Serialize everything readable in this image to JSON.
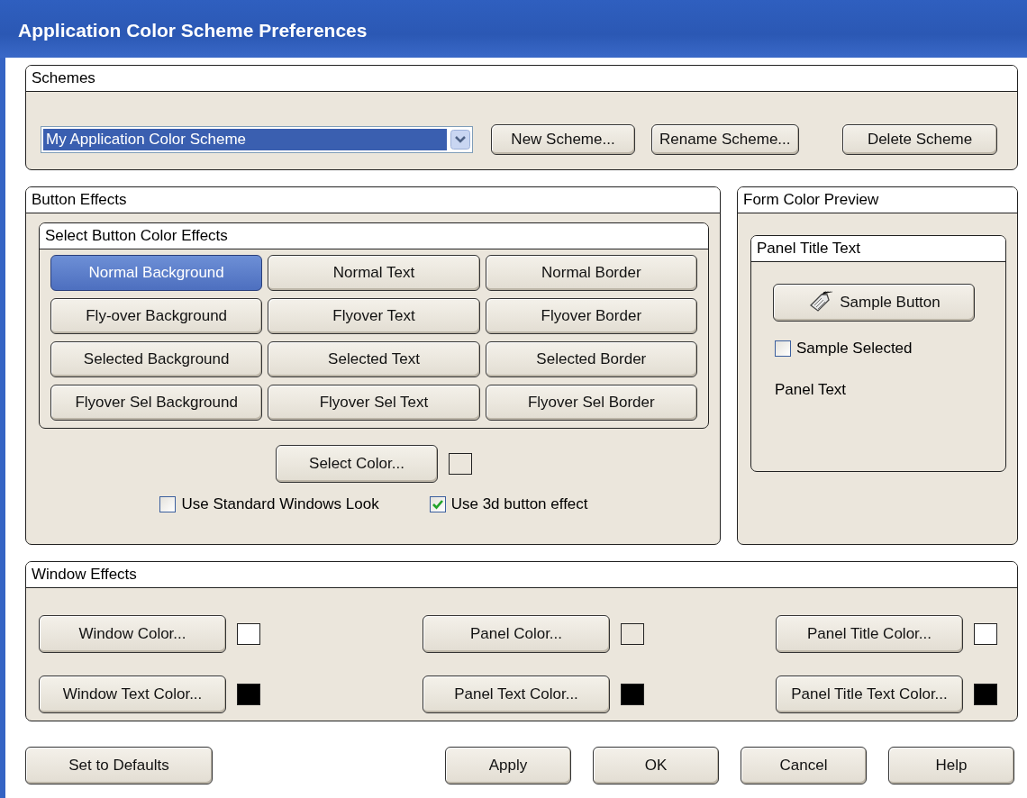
{
  "window": {
    "title": "Application Color Scheme Preferences"
  },
  "schemes": {
    "title": "Schemes",
    "dropdown": {
      "value": "My Application Color Scheme"
    },
    "buttons": [
      "New Scheme...",
      "Rename Scheme...",
      "Delete Scheme"
    ]
  },
  "button_effects": {
    "title": "Button Effects",
    "group_title": "Select Button Color Effects",
    "effects": [
      {
        "label": "Normal Background",
        "selected": true
      },
      {
        "label": "Normal Text",
        "selected": false
      },
      {
        "label": "Normal Border",
        "selected": false
      },
      {
        "label": "Fly-over Background",
        "selected": false
      },
      {
        "label": "Flyover Text",
        "selected": false
      },
      {
        "label": "Flyover Border",
        "selected": false
      },
      {
        "label": "Selected Background",
        "selected": false
      },
      {
        "label": "Selected Text",
        "selected": false
      },
      {
        "label": "Selected Border",
        "selected": false
      },
      {
        "label": "Flyover Sel Background",
        "selected": false
      },
      {
        "label": "Flyover Sel Text",
        "selected": false
      },
      {
        "label": "Flyover Sel Border",
        "selected": false
      }
    ],
    "select_color": {
      "label": "Select Color...",
      "color": "#ebe6dc"
    },
    "checkboxes": [
      {
        "label": "Use Standard Windows Look",
        "checked": false
      },
      {
        "label": "Use 3d button effect",
        "checked": true
      }
    ]
  },
  "preview": {
    "title": "Form Color Preview",
    "panel_title": "Panel Title Text",
    "sample_button": "Sample Button",
    "sample_checkbox": {
      "label": "Sample Selected",
      "checked": false
    },
    "panel_text": "Panel Text"
  },
  "window_effects": {
    "title": "Window Effects",
    "colors": [
      {
        "label": "Window Color...",
        "color": "#ffffff"
      },
      {
        "label": "Panel Color...",
        "color": "#ebe6dc"
      },
      {
        "label": "Panel Title Color...",
        "color": "#ffffff"
      },
      {
        "label": "Window Text Color...",
        "color": "#000000"
      },
      {
        "label": "Panel Text Color...",
        "color": "#000000"
      },
      {
        "label": "Panel Title Text Color...",
        "color": "#000000"
      }
    ]
  },
  "footer": {
    "left": "Set to Defaults",
    "right": [
      "Apply",
      "OK",
      "Cancel",
      "Help"
    ]
  }
}
